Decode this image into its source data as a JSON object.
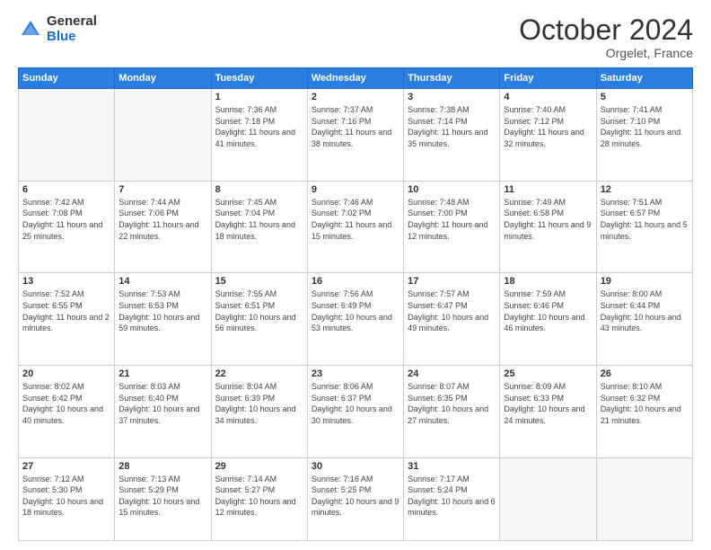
{
  "logo": {
    "general": "General",
    "blue": "Blue"
  },
  "header": {
    "month": "October 2024",
    "location": "Orgelet, France"
  },
  "days_of_week": [
    "Sunday",
    "Monday",
    "Tuesday",
    "Wednesday",
    "Thursday",
    "Friday",
    "Saturday"
  ],
  "weeks": [
    [
      {
        "day": "",
        "sunrise": "",
        "sunset": "",
        "daylight": ""
      },
      {
        "day": "",
        "sunrise": "",
        "sunset": "",
        "daylight": ""
      },
      {
        "day": "1",
        "sunrise": "Sunrise: 7:36 AM",
        "sunset": "Sunset: 7:18 PM",
        "daylight": "Daylight: 11 hours and 41 minutes."
      },
      {
        "day": "2",
        "sunrise": "Sunrise: 7:37 AM",
        "sunset": "Sunset: 7:16 PM",
        "daylight": "Daylight: 11 hours and 38 minutes."
      },
      {
        "day": "3",
        "sunrise": "Sunrise: 7:38 AM",
        "sunset": "Sunset: 7:14 PM",
        "daylight": "Daylight: 11 hours and 35 minutes."
      },
      {
        "day": "4",
        "sunrise": "Sunrise: 7:40 AM",
        "sunset": "Sunset: 7:12 PM",
        "daylight": "Daylight: 11 hours and 32 minutes."
      },
      {
        "day": "5",
        "sunrise": "Sunrise: 7:41 AM",
        "sunset": "Sunset: 7:10 PM",
        "daylight": "Daylight: 11 hours and 28 minutes."
      }
    ],
    [
      {
        "day": "6",
        "sunrise": "Sunrise: 7:42 AM",
        "sunset": "Sunset: 7:08 PM",
        "daylight": "Daylight: 11 hours and 25 minutes."
      },
      {
        "day": "7",
        "sunrise": "Sunrise: 7:44 AM",
        "sunset": "Sunset: 7:06 PM",
        "daylight": "Daylight: 11 hours and 22 minutes."
      },
      {
        "day": "8",
        "sunrise": "Sunrise: 7:45 AM",
        "sunset": "Sunset: 7:04 PM",
        "daylight": "Daylight: 11 hours and 18 minutes."
      },
      {
        "day": "9",
        "sunrise": "Sunrise: 7:46 AM",
        "sunset": "Sunset: 7:02 PM",
        "daylight": "Daylight: 11 hours and 15 minutes."
      },
      {
        "day": "10",
        "sunrise": "Sunrise: 7:48 AM",
        "sunset": "Sunset: 7:00 PM",
        "daylight": "Daylight: 11 hours and 12 minutes."
      },
      {
        "day": "11",
        "sunrise": "Sunrise: 7:49 AM",
        "sunset": "Sunset: 6:58 PM",
        "daylight": "Daylight: 11 hours and 9 minutes."
      },
      {
        "day": "12",
        "sunrise": "Sunrise: 7:51 AM",
        "sunset": "Sunset: 6:57 PM",
        "daylight": "Daylight: 11 hours and 5 minutes."
      }
    ],
    [
      {
        "day": "13",
        "sunrise": "Sunrise: 7:52 AM",
        "sunset": "Sunset: 6:55 PM",
        "daylight": "Daylight: 11 hours and 2 minutes."
      },
      {
        "day": "14",
        "sunrise": "Sunrise: 7:53 AM",
        "sunset": "Sunset: 6:53 PM",
        "daylight": "Daylight: 10 hours and 59 minutes."
      },
      {
        "day": "15",
        "sunrise": "Sunrise: 7:55 AM",
        "sunset": "Sunset: 6:51 PM",
        "daylight": "Daylight: 10 hours and 56 minutes."
      },
      {
        "day": "16",
        "sunrise": "Sunrise: 7:56 AM",
        "sunset": "Sunset: 6:49 PM",
        "daylight": "Daylight: 10 hours and 53 minutes."
      },
      {
        "day": "17",
        "sunrise": "Sunrise: 7:57 AM",
        "sunset": "Sunset: 6:47 PM",
        "daylight": "Daylight: 10 hours and 49 minutes."
      },
      {
        "day": "18",
        "sunrise": "Sunrise: 7:59 AM",
        "sunset": "Sunset: 6:46 PM",
        "daylight": "Daylight: 10 hours and 46 minutes."
      },
      {
        "day": "19",
        "sunrise": "Sunrise: 8:00 AM",
        "sunset": "Sunset: 6:44 PM",
        "daylight": "Daylight: 10 hours and 43 minutes."
      }
    ],
    [
      {
        "day": "20",
        "sunrise": "Sunrise: 8:02 AM",
        "sunset": "Sunset: 6:42 PM",
        "daylight": "Daylight: 10 hours and 40 minutes."
      },
      {
        "day": "21",
        "sunrise": "Sunrise: 8:03 AM",
        "sunset": "Sunset: 6:40 PM",
        "daylight": "Daylight: 10 hours and 37 minutes."
      },
      {
        "day": "22",
        "sunrise": "Sunrise: 8:04 AM",
        "sunset": "Sunset: 6:39 PM",
        "daylight": "Daylight: 10 hours and 34 minutes."
      },
      {
        "day": "23",
        "sunrise": "Sunrise: 8:06 AM",
        "sunset": "Sunset: 6:37 PM",
        "daylight": "Daylight: 10 hours and 30 minutes."
      },
      {
        "day": "24",
        "sunrise": "Sunrise: 8:07 AM",
        "sunset": "Sunset: 6:35 PM",
        "daylight": "Daylight: 10 hours and 27 minutes."
      },
      {
        "day": "25",
        "sunrise": "Sunrise: 8:09 AM",
        "sunset": "Sunset: 6:33 PM",
        "daylight": "Daylight: 10 hours and 24 minutes."
      },
      {
        "day": "26",
        "sunrise": "Sunrise: 8:10 AM",
        "sunset": "Sunset: 6:32 PM",
        "daylight": "Daylight: 10 hours and 21 minutes."
      }
    ],
    [
      {
        "day": "27",
        "sunrise": "Sunrise: 7:12 AM",
        "sunset": "Sunset: 5:30 PM",
        "daylight": "Daylight: 10 hours and 18 minutes."
      },
      {
        "day": "28",
        "sunrise": "Sunrise: 7:13 AM",
        "sunset": "Sunset: 5:29 PM",
        "daylight": "Daylight: 10 hours and 15 minutes."
      },
      {
        "day": "29",
        "sunrise": "Sunrise: 7:14 AM",
        "sunset": "Sunset: 5:27 PM",
        "daylight": "Daylight: 10 hours and 12 minutes."
      },
      {
        "day": "30",
        "sunrise": "Sunrise: 7:16 AM",
        "sunset": "Sunset: 5:25 PM",
        "daylight": "Daylight: 10 hours and 9 minutes."
      },
      {
        "day": "31",
        "sunrise": "Sunrise: 7:17 AM",
        "sunset": "Sunset: 5:24 PM",
        "daylight": "Daylight: 10 hours and 6 minutes."
      },
      {
        "day": "",
        "sunrise": "",
        "sunset": "",
        "daylight": ""
      },
      {
        "day": "",
        "sunrise": "",
        "sunset": "",
        "daylight": ""
      }
    ]
  ]
}
